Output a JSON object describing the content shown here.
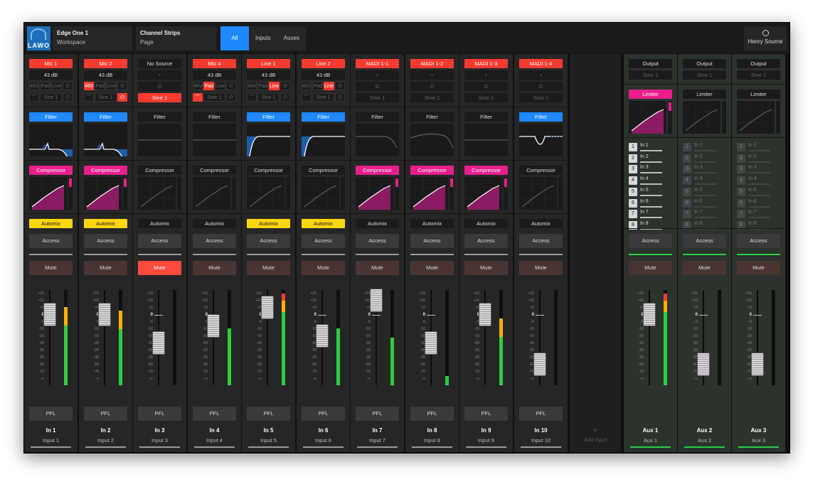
{
  "header": {
    "logo_text": "LAWO",
    "workspace_title": "Edge One 1",
    "workspace_sub": "Workspace",
    "page_title": "Channel Strips",
    "page_sub": "Page",
    "tabs": [
      "All",
      "Inputs",
      "Auxes"
    ],
    "active_tab": "All",
    "user_name": "Henry Sourne"
  },
  "labels": {
    "filter": "Filter",
    "compressor": "Compressor",
    "automix": "Automix",
    "access": "Access",
    "mute": "Mute",
    "pfl": "PFL",
    "limiter": "Limiter",
    "add_input": "Add Input",
    "add_symbol": "+",
    "phantom": "48V",
    "pad": "Pad",
    "line": "Line",
    "dash": "-",
    "phase_symbol": "∅"
  },
  "scale_ticks": [
    "+15",
    "+10",
    "+5",
    "0",
    "-5",
    "-10",
    "-15",
    "-20",
    "-25",
    "-35",
    "-50",
    "-70",
    "-∞"
  ],
  "inputs": [
    {
      "source": "Mic 1",
      "gain": "43 dB",
      "mic_controls": true,
      "flags": {
        "p48": false,
        "pad": false,
        "line": false,
        "phase": false
      },
      "insert": "Sine 1",
      "insert_active": false,
      "filter_active": true,
      "filter_curve": "hpf",
      "comp_active": true,
      "automix_active": true,
      "muted": false,
      "fader_db": 0,
      "meter": 0.82,
      "meter_peak": true,
      "name": "In 1",
      "input": "Input 1"
    },
    {
      "source": "Mic 2",
      "gain": "43 dB",
      "mic_controls": true,
      "flags": {
        "p48": true,
        "pad": false,
        "line": false,
        "phase": true
      },
      "insert": "Sine 1",
      "insert_active": false,
      "filter_active": true,
      "filter_curve": "hpf",
      "comp_active": true,
      "automix_active": true,
      "muted": false,
      "fader_db": 0,
      "meter": 0.78,
      "meter_peak": true,
      "name": "In 2",
      "input": "Input 2"
    },
    {
      "source": "No Source",
      "gain": "-",
      "mic_controls": false,
      "flags": {},
      "insert": "Sine 1",
      "insert_active": true,
      "filter_active": false,
      "filter_curve": "flat",
      "comp_active": false,
      "automix_active": false,
      "muted": true,
      "fader_db": -20,
      "meter": 0,
      "meter_peak": false,
      "name": "In 3",
      "input": "Input 3"
    },
    {
      "source": "Mic 4",
      "gain": "43 dB",
      "mic_controls": true,
      "flags": {
        "p48": false,
        "pad": true,
        "line": false,
        "phase": false
      },
      "insert": "Sine 1",
      "insert_active": false,
      "filter_active": false,
      "filter_curve": "flat",
      "comp_active": false,
      "automix_active": false,
      "muted": false,
      "fader_db": -8,
      "meter": 0.6,
      "meter_peak": false,
      "name": "In 4",
      "input": "Input 4"
    },
    {
      "source": "Line 1",
      "gain": "43 dB",
      "mic_controls": true,
      "flags": {
        "p48": false,
        "pad": false,
        "line": true,
        "phase": false
      },
      "insert": "Sine 1",
      "insert_active": false,
      "filter_active": true,
      "filter_curve": "hpf2",
      "comp_active": false,
      "automix_active": true,
      "muted": false,
      "fader_db": 5,
      "meter": 0.96,
      "meter_peak": true,
      "name": "In 5",
      "input": "Input 5"
    },
    {
      "source": "Line 2",
      "gain": "43 dB",
      "mic_controls": true,
      "flags": {
        "p48": false,
        "pad": false,
        "line": true,
        "phase": false
      },
      "insert": "Sine 1",
      "insert_active": false,
      "filter_active": true,
      "filter_curve": "hpf2",
      "comp_active": false,
      "automix_active": true,
      "muted": false,
      "fader_db": -15,
      "meter": 0.6,
      "meter_peak": false,
      "name": "In 6",
      "input": "Input 6"
    },
    {
      "source": "MADI 1-1",
      "gain": "-",
      "mic_controls": false,
      "flags": {},
      "insert": "Sine 1",
      "insert_active": false,
      "filter_active": false,
      "filter_curve": "lpf",
      "comp_active": true,
      "automix_active": false,
      "muted": false,
      "fader_db": 10,
      "meter": 0.5,
      "meter_peak": false,
      "name": "In 7",
      "input": "Input 7"
    },
    {
      "source": "MADI 1-2",
      "gain": "-",
      "mic_controls": false,
      "flags": {},
      "insert": "Sine 1",
      "insert_active": false,
      "filter_active": false,
      "filter_curve": "hump",
      "comp_active": true,
      "automix_active": false,
      "muted": false,
      "fader_db": -20,
      "meter": 0.1,
      "meter_peak": false,
      "name": "In 8",
      "input": "Input 8"
    },
    {
      "source": "MADI 1-3",
      "gain": "-",
      "mic_controls": false,
      "flags": {},
      "insert": "Sine 1",
      "insert_active": false,
      "filter_active": false,
      "filter_curve": "flat",
      "comp_active": true,
      "automix_active": false,
      "muted": false,
      "fader_db": 0,
      "meter": 0.7,
      "meter_peak": true,
      "name": "In 9",
      "input": "Input 9"
    },
    {
      "source": "MADI 1-4",
      "gain": "-",
      "mic_controls": false,
      "flags": {},
      "insert": "Sine 1",
      "insert_active": false,
      "filter_active": true,
      "filter_curve": "notch",
      "comp_active": false,
      "automix_active": false,
      "muted": false,
      "fader_db": -50,
      "meter": 0,
      "meter_peak": false,
      "name": "In 10",
      "input": "Input 10"
    }
  ],
  "auxes": [
    {
      "output": "Output",
      "insert": "Sine 1",
      "limiter_active": true,
      "buses": [
        "In 1",
        "In 2",
        "In 3",
        "In 4",
        "In 5",
        "In 6",
        "In 7",
        "In 8"
      ],
      "buses_active": true,
      "fader_db": 0,
      "meter": 0.96,
      "meter_peak": true,
      "name": "Aux 1",
      "sub": "Aux 1"
    },
    {
      "output": "Output",
      "insert": "Sine 1",
      "limiter_active": false,
      "buses": [
        "In 1",
        "In 2",
        "In 3",
        "In 4",
        "In 5",
        "In 6",
        "In 7",
        "In 8"
      ],
      "buses_active": false,
      "fader_db": -50,
      "meter": 0,
      "meter_peak": false,
      "name": "Aux 2",
      "sub": "Aux 2"
    },
    {
      "output": "Output",
      "insert": "Sine 1",
      "limiter_active": false,
      "buses": [
        "In 1",
        "In 2",
        "In 3",
        "In 4",
        "In 5",
        "In 6",
        "In 7",
        "In 8"
      ],
      "buses_active": false,
      "fader_db": -50,
      "meter": 0,
      "meter_peak": false,
      "name": "Aux 3",
      "sub": "Aux 3"
    }
  ]
}
